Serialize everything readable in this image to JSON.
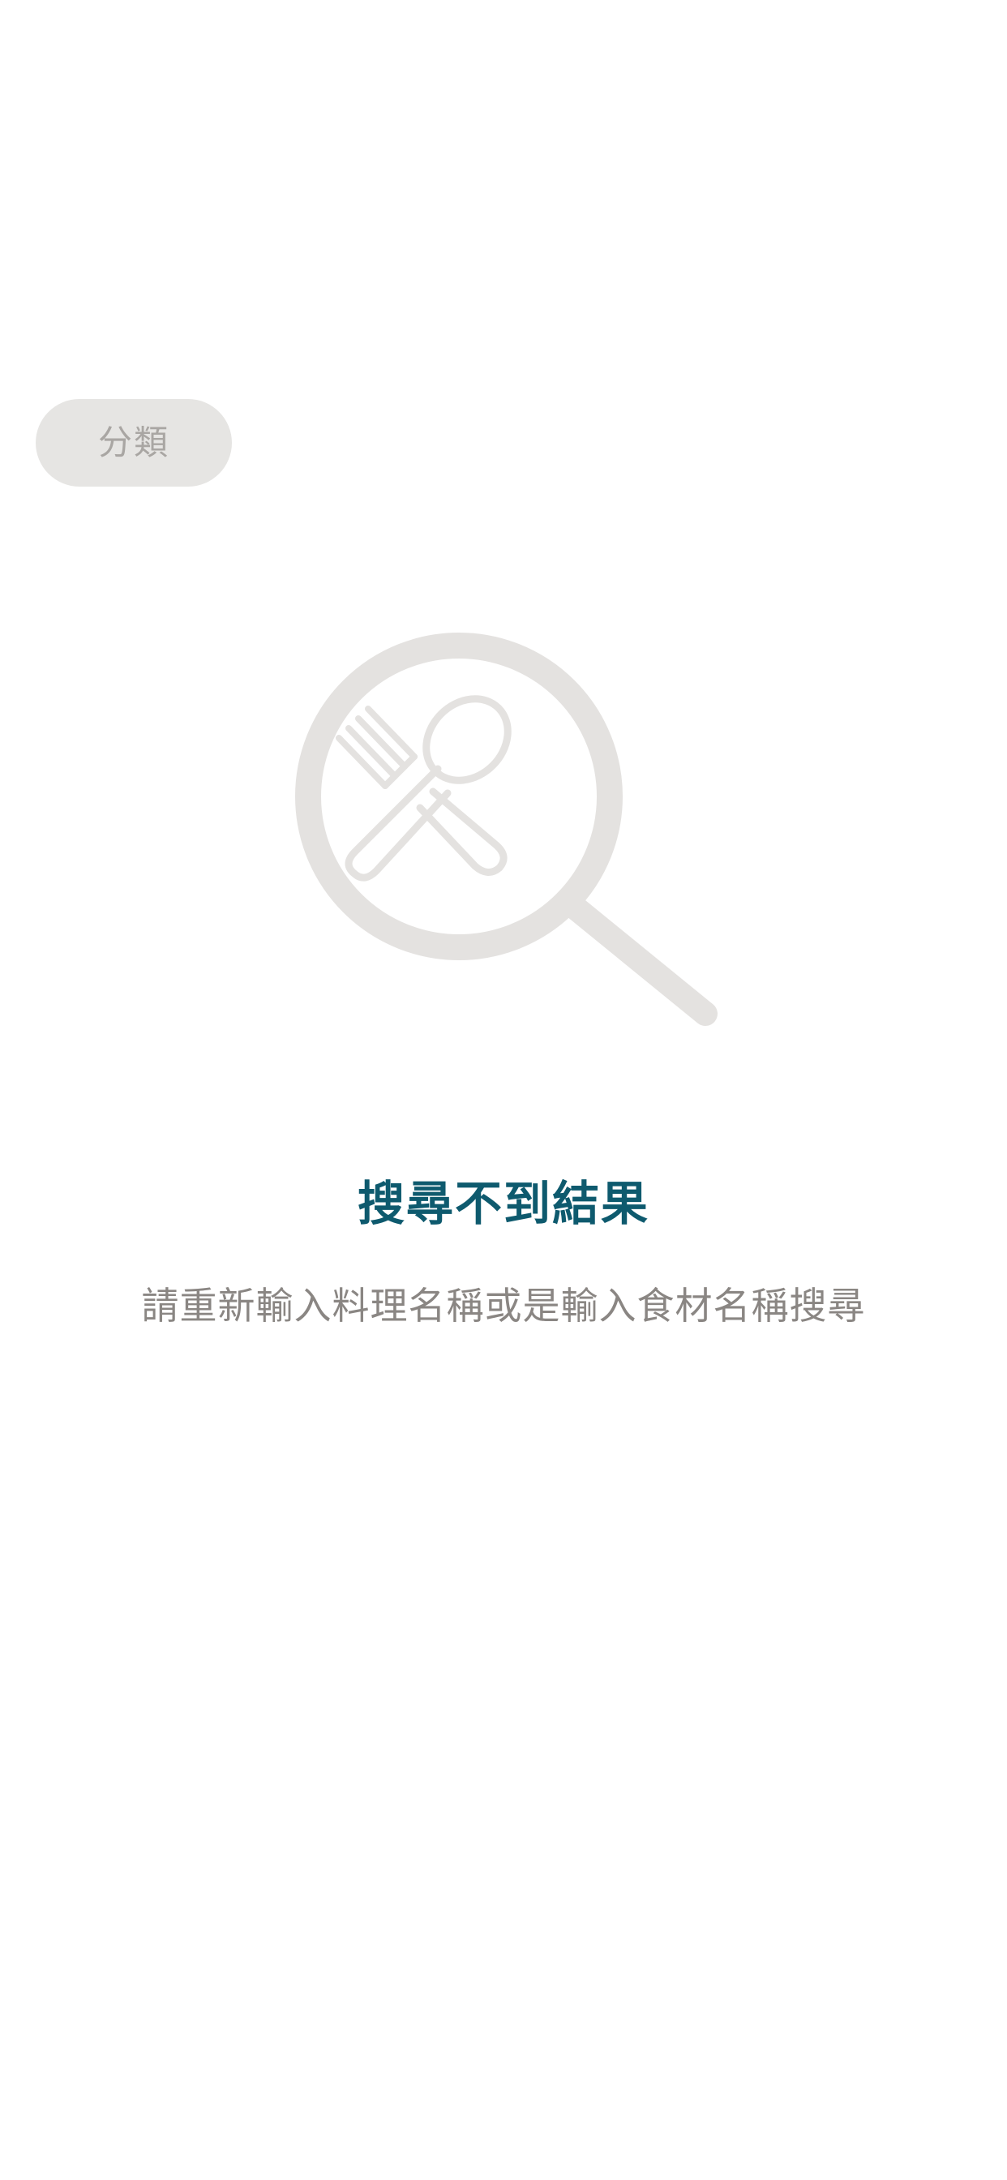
{
  "filter": {
    "category_label": "分類"
  },
  "empty_state": {
    "icon": "magnifier-with-fork-and-spoon-icon",
    "title": "搜尋不到結果",
    "subtitle": "請重新輸入料理名稱或是輸入食材名稱搜尋"
  },
  "colors": {
    "title": "#0e5a6e",
    "subtitle": "#8a8683",
    "chip_bg": "#e6e5e3",
    "chip_text": "#a9a6a3",
    "illustration": "#e4e2e0"
  }
}
